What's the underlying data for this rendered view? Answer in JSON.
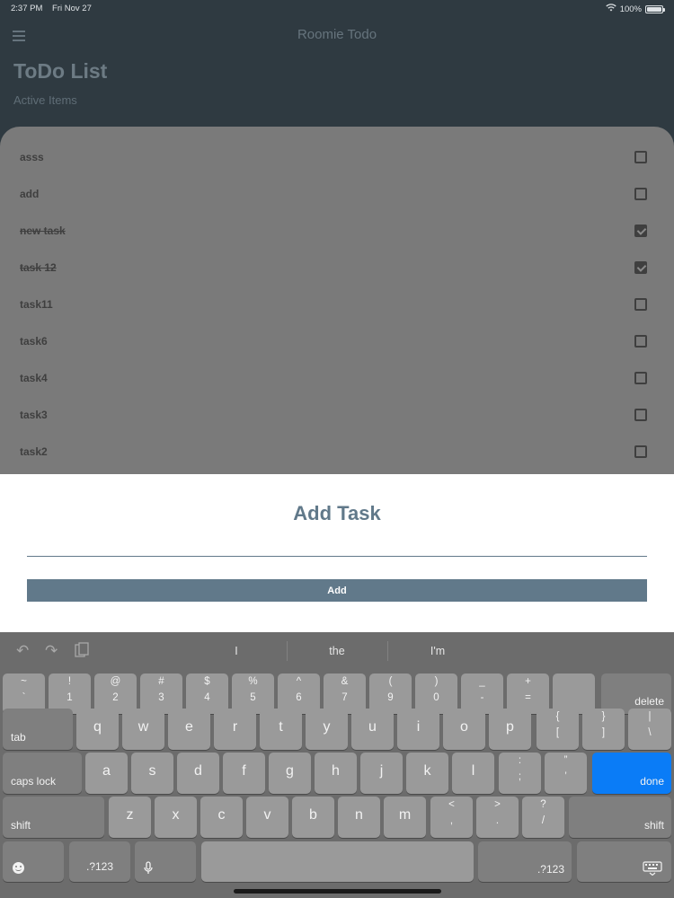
{
  "status_bar": {
    "time": "2:37 PM",
    "date": "Fri Nov 27",
    "battery_percent": "100%",
    "battery_level": 1.0
  },
  "header": {
    "app_title": "Roomie Todo",
    "list_title": "ToDo List",
    "list_subtitle": "Active Items"
  },
  "todos": [
    {
      "label": "asss",
      "done": false
    },
    {
      "label": "add",
      "done": false
    },
    {
      "label": "new task",
      "done": true
    },
    {
      "label": "task 12",
      "done": true
    },
    {
      "label": "task11",
      "done": false
    },
    {
      "label": "task6",
      "done": false
    },
    {
      "label": "task4",
      "done": false
    },
    {
      "label": "task3",
      "done": false
    },
    {
      "label": "task2",
      "done": false
    }
  ],
  "add_task": {
    "title": "Add Task",
    "input_value": "",
    "button_label": "Add"
  },
  "keyboard": {
    "suggestions": [
      "I",
      "the",
      "I'm"
    ],
    "row1": [
      [
        "~",
        "`"
      ],
      [
        "!",
        "1"
      ],
      [
        "@",
        "2"
      ],
      [
        "#",
        "3"
      ],
      [
        "$",
        "4"
      ],
      [
        "%",
        "5"
      ],
      [
        "^",
        "6"
      ],
      [
        "&",
        "7"
      ],
      [
        "(",
        "9"
      ],
      [
        ")",
        "0"
      ],
      [
        "_",
        "-"
      ],
      [
        "+",
        "="
      ]
    ],
    "row2": [
      "q",
      "w",
      "e",
      "r",
      "t",
      "y",
      "u",
      "i",
      "o",
      "p"
    ],
    "row2_brackets": [
      [
        "{",
        "["
      ],
      [
        "}",
        "]"
      ],
      [
        "|",
        "\\"
      ]
    ],
    "row3": [
      "a",
      "s",
      "d",
      "f",
      "g",
      "h",
      "j",
      "k",
      "l"
    ],
    "row3_punct": [
      [
        ":",
        ";"
      ],
      [
        "”",
        "’"
      ]
    ],
    "row4": [
      "z",
      "x",
      "c",
      "v",
      "b",
      "n",
      "m"
    ],
    "row4_punct": [
      [
        "<",
        ","
      ],
      [
        ">",
        "."
      ],
      [
        "?",
        "/"
      ]
    ],
    "labels": {
      "delete": "delete",
      "tab": "tab",
      "caps_lock": "caps lock",
      "done": "done",
      "shift": "shift",
      "numbers": ".?123"
    }
  }
}
